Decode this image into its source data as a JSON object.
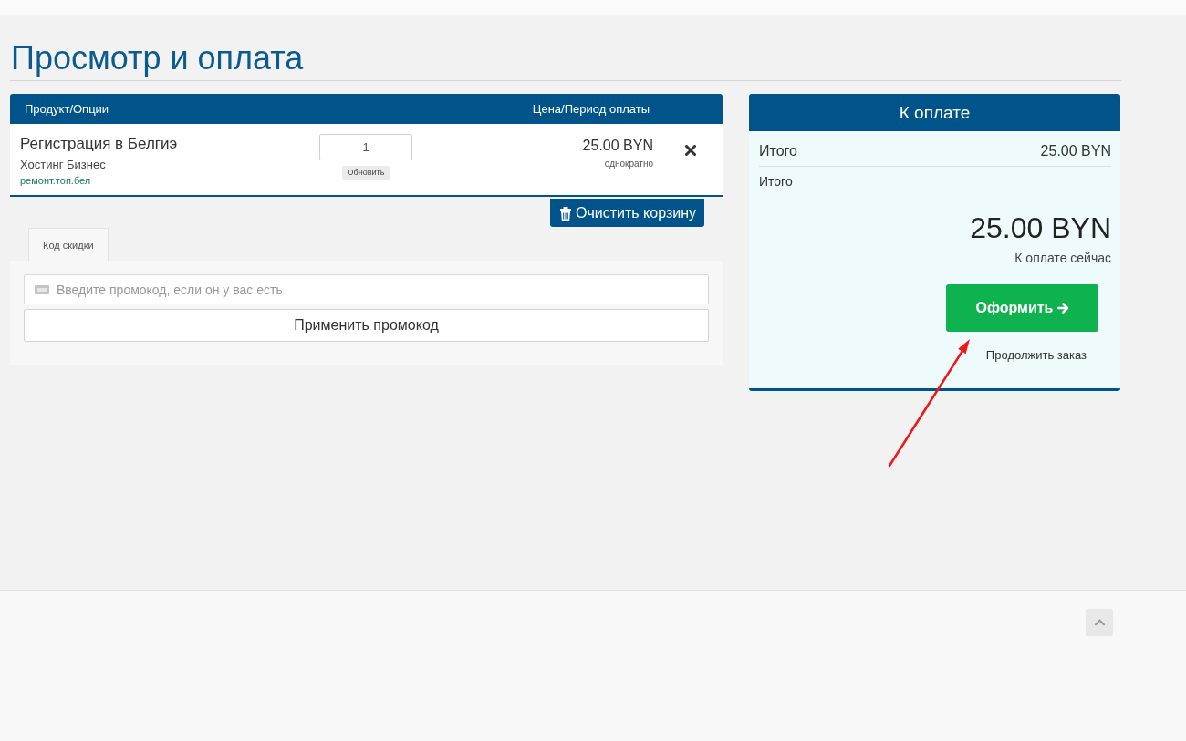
{
  "page_title": "Просмотр и оплата",
  "cart": {
    "columns": [
      "Продукт/Опции",
      "Цена/Период оплаты"
    ],
    "items": [
      {
        "name": "Регистрация в Белгиэ",
        "product": "Хостинг Бизнес",
        "domain": "ремонт.топ.бел",
        "quantity": "1",
        "update_label": "Обновить",
        "price": "25.00 BYN",
        "billing_cycle": "однократно"
      }
    ],
    "clear_button": "Очистить корзину"
  },
  "promo": {
    "tabs": [
      {
        "label": "Код скидки",
        "selected": true
      }
    ],
    "placeholder": "Введите промокод, если он у вас есть",
    "apply_button": "Применить промокод"
  },
  "summary": {
    "title": "К оплате",
    "subtotal_label": "Итого",
    "subtotal_value": "25.00 BYN",
    "total_label": "Итого",
    "total_value": "25.00 BYN",
    "due_label": "К оплате сейчас",
    "checkout_button": "Оформить",
    "continue_link": "Продолжить заказ"
  }
}
